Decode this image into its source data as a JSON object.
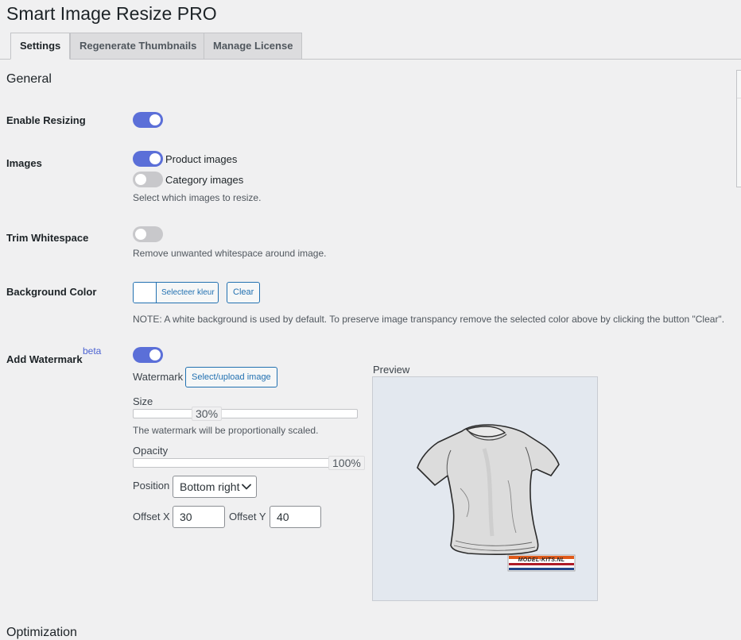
{
  "page": {
    "title": "Smart Image Resize PRO"
  },
  "tabs": [
    {
      "label": "Settings",
      "active": true
    },
    {
      "label": "Regenerate Thumbnails",
      "active": false
    },
    {
      "label": "Manage License",
      "active": false
    }
  ],
  "general": {
    "section_title": "General",
    "enable_resizing": {
      "label": "Enable Resizing",
      "enabled": true
    },
    "images": {
      "label": "Images",
      "options": [
        {
          "label": "Product images",
          "enabled": true
        },
        {
          "label": "Category images",
          "enabled": false
        }
      ],
      "description": "Select which images to resize."
    },
    "trim_whitespace": {
      "label": "Trim Whitespace",
      "enabled": false,
      "description": "Remove unwanted whitespace around image."
    },
    "background_color": {
      "label": "Background Color",
      "swatch_color": "#ffffff",
      "select_label": "Selecteer kleur",
      "clear_label": "Clear",
      "note": "NOTE: A white background is used by default. To preserve image transpancy remove the selected color above by clicking the button \"Clear\"."
    },
    "watermark": {
      "label": "Add Watermark",
      "badge": "beta",
      "enabled": true,
      "watermark_label": "Watermark",
      "select_upload_label": "Select/upload image",
      "size": {
        "label": "Size",
        "value": 30,
        "display": "30%",
        "description": "The watermark will be proportionally scaled."
      },
      "opacity": {
        "label": "Opacity",
        "value": 100,
        "display": "100%"
      },
      "position": {
        "label": "Position",
        "selected": "Bottom right"
      },
      "offset_x": {
        "label": "Offset X",
        "value": "30"
      },
      "offset_y": {
        "label": "Offset Y",
        "value": "40"
      },
      "preview": {
        "label": "Preview",
        "watermark_text": "MODEL-KITS.NL"
      }
    }
  },
  "optimization": {
    "section_title": "Optimization"
  },
  "colors": {
    "accent": "#5b6fd8",
    "link": "#2271b1",
    "toggle_off": "#c8c8cb",
    "preview_bg": "#e3e8ef"
  },
  "icons": {
    "select_chevron": "chevron-down-icon",
    "preview_image": "t-shirt-icon"
  }
}
